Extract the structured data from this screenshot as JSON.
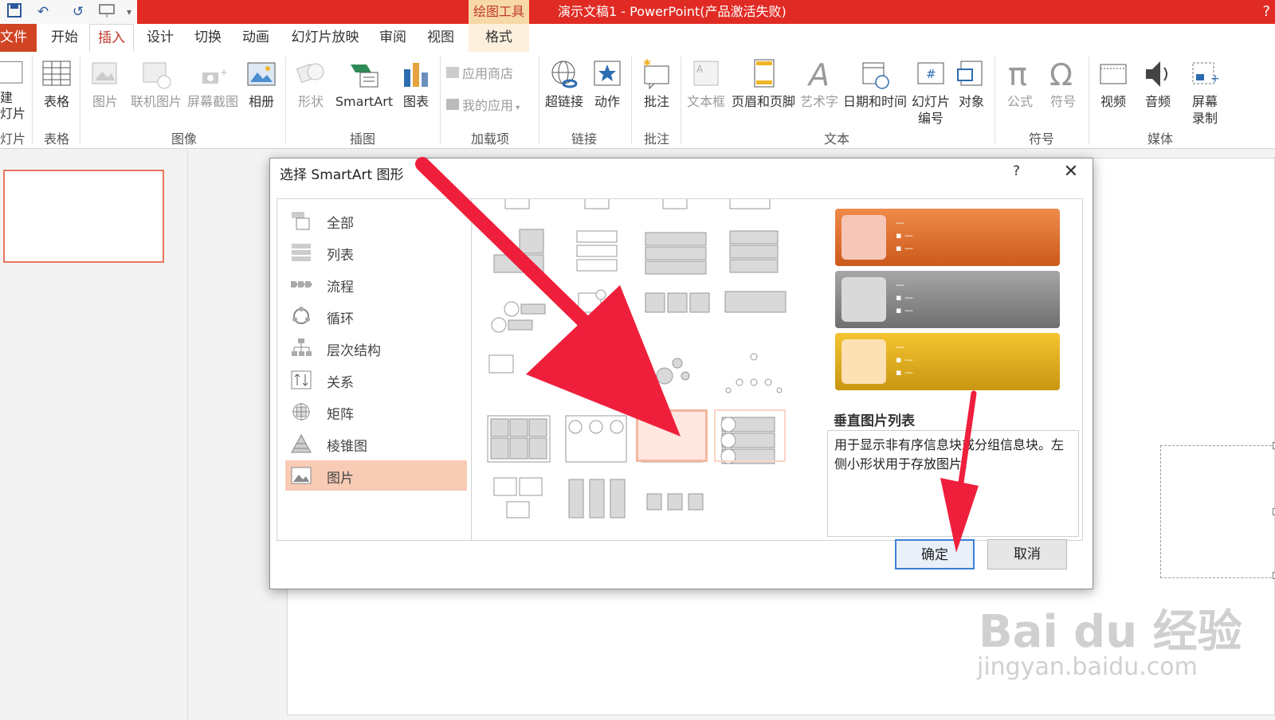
{
  "window": {
    "title": "演示文稿1 -  PowerPoint(产品激活失败)",
    "context_tab_header": "绘图工具",
    "help": "?"
  },
  "tabs": [
    {
      "label": "文件"
    },
    {
      "label": "开始"
    },
    {
      "label": "插入"
    },
    {
      "label": "设计"
    },
    {
      "label": "切换"
    },
    {
      "label": "动画"
    },
    {
      "label": "幻灯片放映"
    },
    {
      "label": "审阅"
    },
    {
      "label": "视图"
    },
    {
      "label": "格式"
    }
  ],
  "active_tab": "插入",
  "ribbon": {
    "new_slide_partial": "建\n灯片",
    "slides_group_partial": "灯片",
    "table": "表格",
    "tables_group": "表格",
    "picture": "图片",
    "online_picture": "联机图片",
    "screenshot": "屏幕截图",
    "album": "相册",
    "images_group": "图像",
    "shapes": "形状",
    "smartart": "SmartArt",
    "chart": "图表",
    "illustrations_group": "插图",
    "store": "应用商店",
    "my_apps": "我的应用",
    "addins_group": "加载项",
    "hyperlink": "超链接",
    "action": "动作",
    "links_group": "链接",
    "comment": "批注",
    "comments_group": "批注",
    "textbox": "文本框",
    "header_footer": "页眉和页脚",
    "wordart": "艺术字",
    "datetime": "日期和时间",
    "slide_number_1": "幻灯片",
    "slide_number_2": "编号",
    "object": "对象",
    "text_group": "文本",
    "equation": "公式",
    "symbol": "符号",
    "symbols_group": "符号",
    "video": "视频",
    "audio": "音频",
    "screen_rec_1": "屏幕",
    "screen_rec_2": "录制",
    "media_group": "媒体"
  },
  "dialog": {
    "title": "选择 SmartArt 图形",
    "help": "?",
    "close": "✕",
    "categories": [
      {
        "label": "全部"
      },
      {
        "label": "列表"
      },
      {
        "label": "流程"
      },
      {
        "label": "循环"
      },
      {
        "label": "层次结构"
      },
      {
        "label": "关系"
      },
      {
        "label": "矩阵"
      },
      {
        "label": "棱锥图"
      },
      {
        "label": "图片"
      }
    ],
    "selected_category": "图片",
    "preview_name": "垂直图片列表",
    "preview_description": "用于显示非有序信息块或分组信息块。左侧小形状用于存放图片。",
    "ok": "确定",
    "cancel": "取消",
    "scroll_up": "⌃",
    "scroll_down": "⌄"
  },
  "watermark": {
    "brand": "Bai du 经验",
    "url": "jingyan.baidu.com"
  },
  "colors": {
    "title_bar": "#e02b24",
    "file_tab": "#d04423",
    "selected_category": "#f8cbb5",
    "arrow": "#ef1f3c",
    "preview_orange": "#e0692a",
    "preview_gray": "#8a8a8a",
    "preview_gold": "#e2b01a"
  }
}
